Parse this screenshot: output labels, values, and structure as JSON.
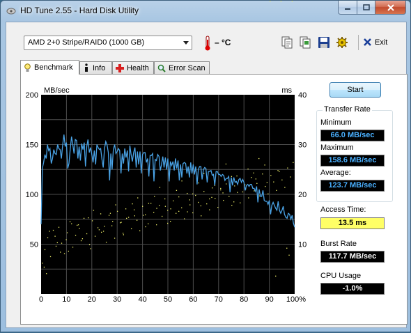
{
  "window": {
    "title": "HD Tune 2.55 - Hard Disk Utility"
  },
  "toolbar": {
    "drive": "AMD     2+0 Stripe/RAID0 (1000 GB)",
    "temperature": "– °C",
    "exit_label": "Exit"
  },
  "tabs": [
    {
      "label": "Benchmark",
      "icon": "lightbulb-icon",
      "active": true
    },
    {
      "label": "Info",
      "icon": "info-icon"
    },
    {
      "label": "Health",
      "icon": "red-cross-icon"
    },
    {
      "label": "Error Scan",
      "icon": "magnifier-icon"
    }
  ],
  "side": {
    "start_label": "Start",
    "transfer_rate_title": "Transfer Rate",
    "minimum_label": "Minimum",
    "minimum_value": "66.0 MB/sec",
    "maximum_label": "Maximum",
    "maximum_value": "158.6 MB/sec",
    "average_label": "Average:",
    "average_value": "123.7 MB/sec",
    "access_time_label": "Access Time:",
    "access_time_value": "13.5 ms",
    "burst_rate_label": "Burst Rate",
    "burst_rate_value": "117.7 MB/sec",
    "cpu_usage_label": "CPU Usage",
    "cpu_usage_value": "-1.0%"
  },
  "colors": {
    "plot_bg": "#000000",
    "grid": "#4d4d4d",
    "transfer_line": "#4aa3e6",
    "access_dots": "#f0f06a",
    "value_blue": "#4ab0ff",
    "value_yellow": "#ffff66",
    "value_white": "#ffffff"
  },
  "chart_data": {
    "type": "line",
    "left_unit": "MB/sec",
    "right_unit": "ms",
    "left_ticks": [
      "200",
      "150",
      "100",
      "50"
    ],
    "right_ticks": [
      "40",
      "30",
      "20",
      "10"
    ],
    "x_ticks": [
      "0",
      "10",
      "20",
      "30",
      "40",
      "50",
      "60",
      "70",
      "80",
      "90",
      "100%"
    ],
    "xlim": [
      0,
      100
    ],
    "ylim_left": [
      0,
      200
    ],
    "ylim_right": [
      0,
      40
    ],
    "grid": true,
    "series": [
      {
        "axis": "left",
        "x": [
          0,
          0.5,
          1,
          1.5,
          2,
          2.5,
          3,
          3.5,
          4,
          4.5,
          5,
          5.5,
          6,
          6.5,
          7,
          7.5,
          8,
          8.5,
          9,
          9.5,
          10,
          10.5,
          11,
          11.5,
          12,
          12.5,
          13,
          13.5,
          14,
          14.5,
          15,
          15.5,
          16,
          16.5,
          17,
          17.5,
          18,
          18.5,
          19,
          19.5,
          20,
          20.5,
          21,
          21.5,
          22,
          22.5,
          23,
          23.5,
          24,
          24.5,
          25,
          25.5,
          26,
          26.5,
          27,
          27.5,
          28,
          28.5,
          29,
          29.5,
          30,
          30.5,
          31,
          31.5,
          32,
          32.5,
          33,
          33.5,
          34,
          34.5,
          35,
          35.5,
          36,
          36.5,
          37,
          37.5,
          38,
          38.5,
          39,
          39.5,
          40,
          40.5,
          41,
          41.5,
          42,
          42.5,
          43,
          43.5,
          44,
          44.5,
          45,
          45.5,
          46,
          46.5,
          47,
          47.5,
          48,
          48.5,
          49,
          49.5,
          50,
          50.5,
          51,
          51.5,
          52,
          52.5,
          53,
          53.5,
          54,
          54.5,
          55,
          55.5,
          56,
          56.5,
          57,
          57.5,
          58,
          58.5,
          59,
          59.5,
          60,
          60.5,
          61,
          61.5,
          62,
          62.5,
          63,
          63.5,
          64,
          64.5,
          65,
          65.5,
          66,
          66.5,
          67,
          67.5,
          68,
          68.5,
          69,
          69.5,
          70,
          70.5,
          71,
          71.5,
          72,
          72.5,
          73,
          73.5,
          74,
          74.5,
          75,
          75.5,
          76,
          76.5,
          77,
          77.5,
          78,
          78.5,
          79,
          79.5,
          80,
          80.5,
          81,
          81.5,
          82,
          82.5,
          83,
          83.5,
          84,
          84.5,
          85,
          85.5,
          86,
          86.5,
          87,
          87.5,
          88,
          88.5,
          89,
          89.5,
          90,
          90.5,
          91,
          91.5,
          92,
          92.5,
          93,
          93.5,
          94,
          94.5,
          95,
          95.5,
          96,
          96.5,
          97,
          97.5,
          98,
          98.5,
          99,
          99.5,
          100
        ],
        "y": [
          70,
          126,
          132,
          140,
          136,
          150,
          144,
          146,
          131,
          136,
          145,
          141,
          140,
          150,
          146,
          145,
          136,
          149,
          160,
          148,
          152,
          126,
          131,
          146,
          158,
          150,
          141,
          155,
          154,
          136,
          148,
          134,
          151,
          145,
          152,
          128,
          148,
          155,
          142,
          147,
          140,
          132,
          144,
          130,
          150,
          147,
          145,
          146,
          135,
          127,
          146,
          153,
          150,
          142,
          114,
          141,
          125,
          145,
          150,
          141,
          143,
          146,
          144,
          121,
          141,
          131,
          146,
          137,
          144,
          123,
          149,
          140,
          133,
          142,
          147,
          127,
          143,
          130,
          143,
          121,
          140,
          142,
          142,
          132,
          136,
          118,
          139,
          139,
          141,
          113,
          135,
          134,
          140,
          138,
          124,
          130,
          138,
          127,
          137,
          125,
          136,
          113,
          133,
          129,
          133,
          124,
          136,
          126,
          134,
          114,
          130,
          117,
          131,
          132,
          131,
          121,
          128,
          117,
          132,
          121,
          130,
          120,
          128,
          110,
          125,
          128,
          128,
          115,
          125,
          127,
          126,
          112,
          123,
          123,
          124,
          119,
          120,
          109,
          123,
          123,
          120,
          120,
          118,
          120,
          119,
          114,
          116,
          116,
          118,
          102,
          117,
          109,
          117,
          112,
          113,
          110,
          115,
          116,
          112,
          115,
          112,
          104,
          109,
          110,
          108,
          110,
          110,
          106,
          106,
          103,
          108,
          92,
          105,
          98,
          98,
          104,
          94,
          93,
          93,
          90,
          94,
          80,
          89,
          92,
          89,
          86,
          84,
          93,
          84,
          81,
          84,
          88,
          80,
          77,
          76,
          81,
          80,
          75,
          79,
          71,
          67
        ]
      }
    ],
    "scatter_series": [
      {
        "axis": "right",
        "x": [
          0.5,
          1.5,
          2.6,
          3.7,
          4.8,
          5.9,
          7.0,
          8.1,
          9.2,
          10.3,
          11.4,
          12.5,
          13.6,
          14.7,
          15.8,
          16.9,
          18.0,
          19.1,
          20.2,
          21.3,
          22.4,
          23.5,
          24.6,
          25.7,
          26.8,
          27.9,
          29.0,
          30.1,
          31.2,
          32.3,
          33.4,
          34.5,
          35.6,
          36.7,
          37.8,
          38.9,
          40.0,
          41.1,
          42.2,
          43.3,
          44.4,
          45.5,
          46.6,
          47.7,
          48.8,
          49.9,
          51.0,
          52.1,
          53.2,
          54.3,
          55.4,
          56.5,
          57.6,
          58.7,
          59.8,
          60.9,
          62.0,
          63.1,
          64.2,
          65.3,
          66.4,
          67.5,
          68.6,
          69.7,
          70.8,
          71.9,
          73.0,
          74.1,
          75.2,
          76.3,
          77.4,
          78.5,
          79.6,
          80.7,
          81.8,
          82.9,
          84.0,
          85.1,
          86.2,
          87.3,
          88.4,
          89.5,
          90.6,
          91.7,
          92.8,
          93.9,
          95.0,
          96.1,
          97.2,
          98.3,
          99.4,
          2.1,
          6.4,
          10.8,
          15.1,
          19.5,
          23.8,
          28.2,
          32.5,
          36.9,
          41.2,
          45.6,
          49.9,
          54.3,
          58.6,
          63.0,
          67.3,
          71.7,
          76.0,
          80.4,
          84.7,
          89.1,
          93.4,
          97.8,
          1.2,
          5.5,
          9.9,
          14.2,
          18.6,
          22.9,
          27.3,
          31.6,
          36.0,
          40.3,
          44.7,
          49.0,
          53.4,
          57.7,
          62.1,
          66.4,
          70.8,
          75.1,
          79.5,
          83.8,
          88.2,
          92.5,
          96.9,
          3.3,
          7.6,
          12.0,
          16.3,
          20.7,
          25.0,
          29.4,
          33.7,
          38.1,
          42.4,
          46.8,
          51.1,
          55.5,
          59.8,
          64.2,
          68.5,
          72.9,
          77.2,
          81.6,
          85.9,
          90.3,
          94.6,
          99.0
        ],
        "y": [
          6.2,
          8.9,
          11.3,
          7.5,
          12.8,
          9.6,
          13.4,
          10.2,
          8.1,
          12.3,
          14.5,
          9.4,
          11.8,
          13.9,
          10.7,
          15.2,
          12.1,
          9.9,
          14.7,
          11.6,
          13.3,
          16.1,
          12.6,
          10.4,
          15.8,
          13.7,
          11.2,
          16.6,
          14.3,
          12.2,
          17.1,
          15.4,
          13.1,
          16.9,
          14.8,
          12.7,
          17.6,
          15.9,
          14.1,
          18.2,
          16.4,
          13.9,
          17.8,
          15.6,
          19.1,
          16.8,
          14.6,
          18.7,
          16.2,
          19.5,
          17.3,
          15.1,
          20.2,
          17.9,
          16.3,
          19.8,
          18.4,
          15.7,
          20.6,
          18.1,
          16.9,
          21.3,
          19.2,
          17.4,
          20.9,
          18.8,
          22.1,
          19.6,
          17.8,
          21.7,
          20.4,
          18.3,
          22.8,
          21.1,
          19.3,
          23.4,
          20.7,
          22.2,
          19.7,
          24.1,
          21.6,
          20.1,
          23.8,
          22.5,
          20.8,
          24.6,
          22.9,
          21.4,
          25.3,
          23.5,
          26.4,
          4.1,
          10.3,
          8.6,
          13.2,
          9.1,
          12.4,
          14.6,
          11.9,
          15.7,
          13.5,
          17.2,
          14.2,
          16.6,
          18.9,
          17.7,
          19.4,
          20.3,
          18.5,
          21.9,
          23.1,
          22.4,
          24.8,
          7.8,
          5.4,
          11.6,
          10.9,
          13.8,
          15.3,
          12.9,
          16.2,
          14.4,
          18.1,
          15.8,
          19.6,
          17.6,
          20.8,
          16.5,
          22.3,
          19.1,
          21.2,
          23.6,
          20.5,
          24.3,
          25.9,
          3.6,
          9.2,
          12.6,
          8.4,
          14.1,
          11.1,
          16.8,
          13.6,
          17.9,
          15.2,
          19.3,
          18.2,
          21.4,
          17.1,
          22.7,
          20.1,
          24.2,
          21.8,
          26.1,
          23.7,
          25.1,
          27.2
        ]
      }
    ]
  }
}
